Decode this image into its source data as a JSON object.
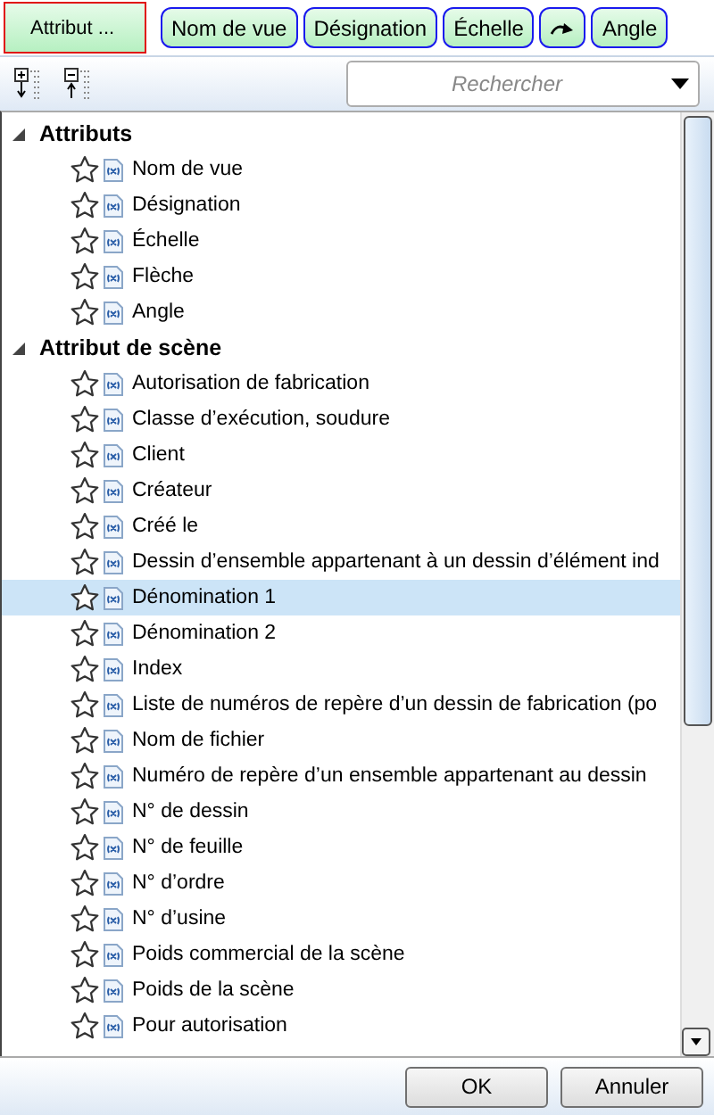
{
  "top_buttons": [
    {
      "kind": "text",
      "label": "Attribut ...",
      "selected": true
    },
    {
      "kind": "text",
      "label": "Nom de vue",
      "selected": false
    },
    {
      "kind": "text",
      "label": "Désignation",
      "selected": false
    },
    {
      "kind": "text",
      "label": "Échelle",
      "selected": false
    },
    {
      "kind": "icon",
      "selected": false
    },
    {
      "kind": "text",
      "label": "Angle",
      "selected": false
    }
  ],
  "search": {
    "placeholder": "Rechercher"
  },
  "groups": [
    {
      "label": "Attributs",
      "expanded": true,
      "items": [
        {
          "label": "Nom de vue",
          "selected": false
        },
        {
          "label": "Désignation",
          "selected": false
        },
        {
          "label": "Échelle",
          "selected": false
        },
        {
          "label": "Flèche",
          "selected": false
        },
        {
          "label": "Angle",
          "selected": false
        }
      ]
    },
    {
      "label": "Attribut de scène",
      "expanded": true,
      "items": [
        {
          "label": "Autorisation de fabrication",
          "selected": false
        },
        {
          "label": "Classe d’exécution, soudure",
          "selected": false
        },
        {
          "label": "Client",
          "selected": false
        },
        {
          "label": "Créateur",
          "selected": false
        },
        {
          "label": "Créé le",
          "selected": false
        },
        {
          "label": "Dessin d’ensemble appartenant à un dessin d’élément ind",
          "selected": false
        },
        {
          "label": "Dénomination 1",
          "selected": true
        },
        {
          "label": "Dénomination 2",
          "selected": false
        },
        {
          "label": "Index",
          "selected": false
        },
        {
          "label": "Liste de numéros de repère d’un dessin de fabrication (po",
          "selected": false
        },
        {
          "label": "Nom de fichier",
          "selected": false
        },
        {
          "label": "Numéro de repère d’un ensemble appartenant au dessin",
          "selected": false
        },
        {
          "label": "N° de dessin",
          "selected": false
        },
        {
          "label": "N° de feuille",
          "selected": false
        },
        {
          "label": "N° d’ordre",
          "selected": false
        },
        {
          "label": "N° d’usine",
          "selected": false
        },
        {
          "label": "Poids commercial de la scène",
          "selected": false
        },
        {
          "label": "Poids de la scène",
          "selected": false
        },
        {
          "label": "Pour autorisation",
          "selected": false
        }
      ]
    }
  ],
  "buttons": [
    "OK",
    "Annuler"
  ]
}
